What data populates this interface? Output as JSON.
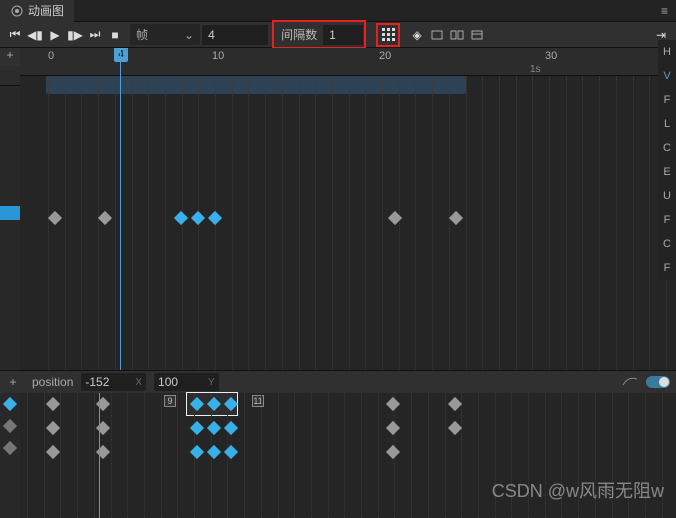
{
  "tab": {
    "title": "动画图",
    "icon": "animation-icon"
  },
  "toolbar": {
    "dropdown_label": "帧",
    "frame_value": "4",
    "interval_label": "间隔数",
    "interval_value": "1"
  },
  "ruler": {
    "ticks": [
      "0",
      "10",
      "20",
      "30"
    ],
    "second_marker": "1s",
    "playhead_frame": "4"
  },
  "rightPanel": {
    "items": [
      "H",
      "V",
      "F",
      "L",
      "C",
      "E",
      "U",
      "F",
      "C",
      "F"
    ],
    "active_index": 1
  },
  "bottom": {
    "property_label": "position",
    "x_value": "-152",
    "x_axis": "X",
    "y_value": "100",
    "y_axis": "Y",
    "frame_numbers": [
      "9",
      "11"
    ]
  },
  "watermark": "CSDN @w风雨无阻w"
}
